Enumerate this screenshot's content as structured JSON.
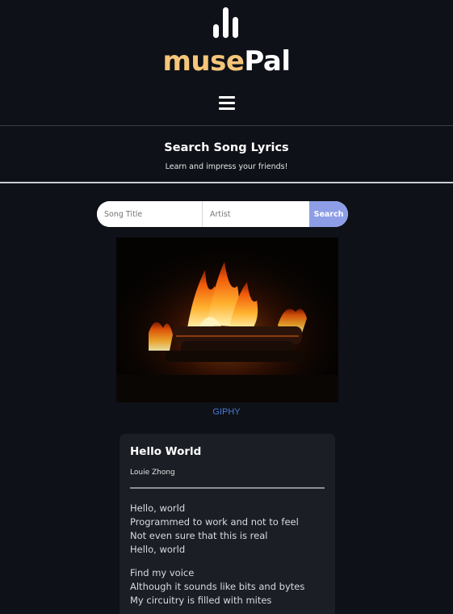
{
  "brand": {
    "name_part1": "muse",
    "name_part2": "Pal",
    "accent_color": "#f5c57a",
    "logo_icon": "equalizer-bars-icon",
    "menu_icon": "hamburger-menu-icon"
  },
  "hero": {
    "title": "Search Song Lyrics",
    "subtitle": "Learn and impress your friends!"
  },
  "search": {
    "title_placeholder": "Song Title",
    "artist_placeholder": "Artist",
    "button_label": "Search",
    "button_color": "#8e9ee6"
  },
  "gif": {
    "credit": "GIPHY"
  },
  "song": {
    "title": "Hello World",
    "artist": "Louie Zhong",
    "stanzas": [
      [
        "Hello, world",
        "Programmed to work and not to feel",
        "Not even sure that this is real",
        "Hello, world"
      ],
      [
        "Find my voice",
        "Although it sounds like bits and bytes",
        "My circuitry is filled with mites"
      ]
    ]
  }
}
